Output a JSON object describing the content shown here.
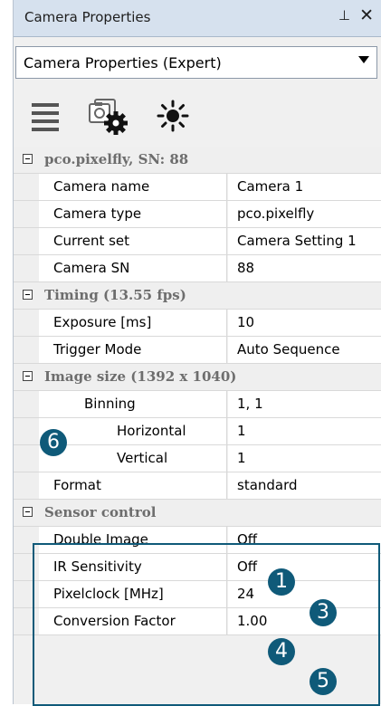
{
  "panel": {
    "title": "Camera Properties",
    "pin_glyph": "⊥",
    "close_glyph": "✕"
  },
  "dropdown": {
    "selected": "Camera Properties (Expert)"
  },
  "toolbar": {
    "icons": [
      "list-icon",
      "camera-settings-icon",
      "brightness-icon"
    ]
  },
  "categories": {
    "camera": {
      "label": "pco.pixelfly, SN: 88"
    },
    "timing": {
      "label": "Timing (13.55 fps)"
    },
    "image": {
      "label": "Image size (1392 x 1040)"
    },
    "sensor": {
      "label": "Sensor control"
    }
  },
  "rows": {
    "camera_name": {
      "name": "Camera name",
      "value": "Camera 1"
    },
    "camera_type": {
      "name": "Camera type",
      "value": "pco.pixelfly"
    },
    "current_set": {
      "name": "Current set",
      "value": "Camera Setting 1"
    },
    "camera_sn": {
      "name": "Camera SN",
      "value": "88"
    },
    "exposure": {
      "name": "Exposure [ms]",
      "value": "10"
    },
    "trigger_mode": {
      "name": "Trigger Mode",
      "value": "Auto Sequence"
    },
    "binning": {
      "name": "Binning",
      "value": "1, 1"
    },
    "horizontal": {
      "name": "Horizontal",
      "value": "1"
    },
    "vertical": {
      "name": "Vertical",
      "value": "1"
    },
    "format": {
      "name": "Format",
      "value": "standard"
    },
    "double_image": {
      "name": "Double Image",
      "value": "Off"
    },
    "ir_sensitivity": {
      "name": "IR Sensitivity",
      "value": "Off"
    },
    "pixelclock": {
      "name": "Pixelclock [MHz]",
      "value": "24"
    },
    "conversion_factor": {
      "name": "Conversion Factor",
      "value": "1.00"
    }
  },
  "badges": {
    "b1": "1",
    "b3": "3",
    "b4": "4",
    "b5": "5",
    "b6": "6"
  },
  "colors": {
    "accent": "#0f5a79",
    "titlebar": "#d6e1ee",
    "category_text": "#6d6d6d"
  }
}
